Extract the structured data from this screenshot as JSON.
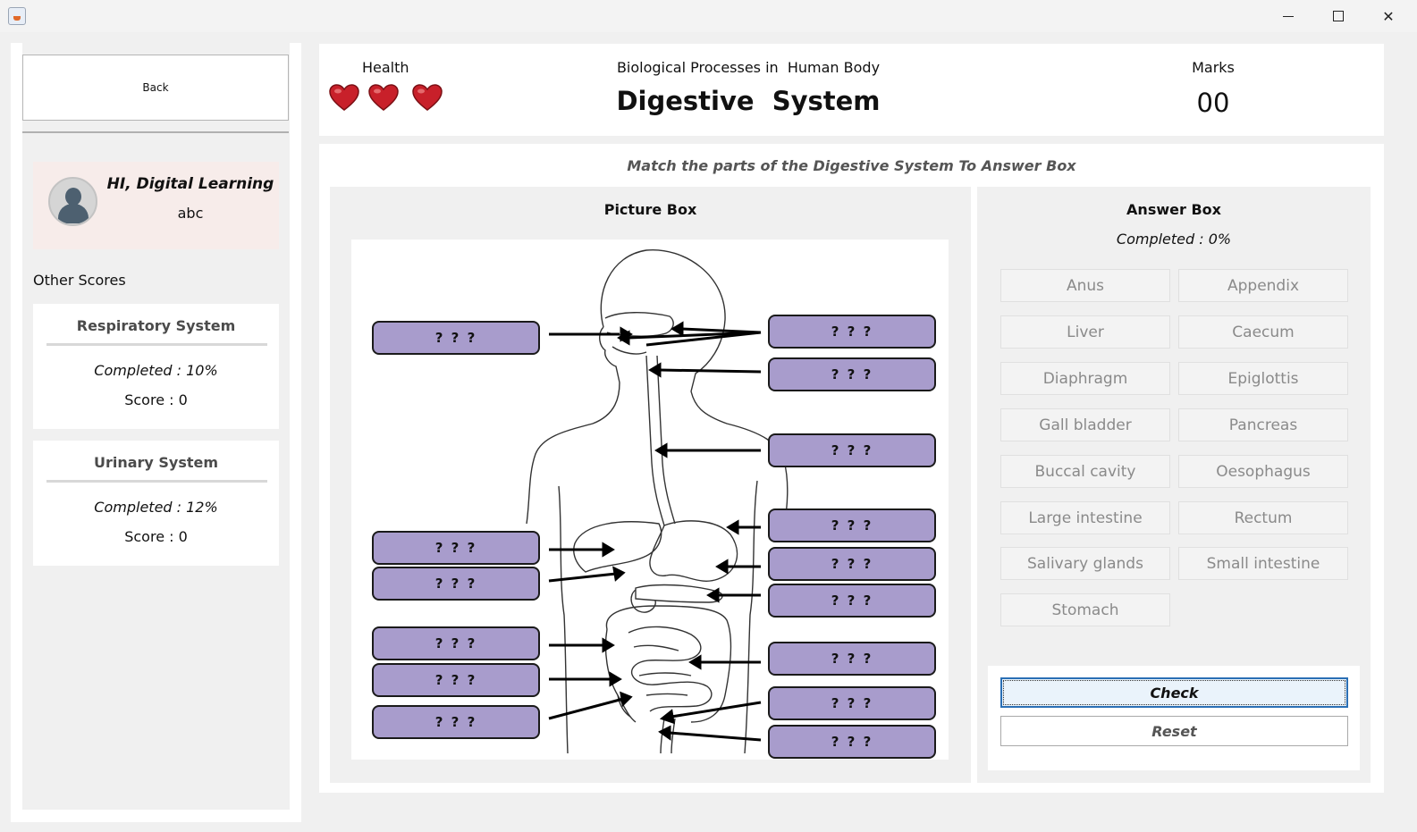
{
  "window": {
    "minimize_glyph": "",
    "close_glyph": "✕"
  },
  "sidebar": {
    "back_label": "Back",
    "greeting": "HI, Digital Learning",
    "username": "abc",
    "other_scores_label": "Other Scores",
    "score_cards": [
      {
        "title": "Respiratory System",
        "completed": "Completed : 10%",
        "score": "Score : 0"
      },
      {
        "title": "Urinary System",
        "completed": "Completed : 12%",
        "score": "Score : 0"
      }
    ]
  },
  "header": {
    "health_label": "Health",
    "health_count": 3,
    "subtitle": "Biological Processes in  Human Body",
    "title": "Digestive  System",
    "marks_label": "Marks",
    "marks_value": "00"
  },
  "game": {
    "instruction": "Match the parts of the Digestive System To Answer Box",
    "picture_box_title": "Picture Box",
    "slot_text": "? ? ?",
    "answer_box_title": "Answer Box",
    "completed": "Completed : 0%",
    "answers": [
      "Anus",
      "Appendix",
      "Liver",
      "Caecum",
      "Diaphragm",
      "Epiglottis",
      "Gall bladder",
      "Pancreas",
      "Buccal cavity",
      "Oesophagus",
      "Large intestine",
      "Rectum",
      "Salivary glands",
      "Small intestine",
      "Stomach"
    ],
    "check_label": "Check",
    "reset_label": "Reset"
  },
  "colors": {
    "slot_fill": "#a89ccc",
    "heart": "#c8202a",
    "check_border": "#2a6fb5"
  },
  "icons": {
    "health": "heart-icon",
    "avatar": "user-avatar-icon",
    "app": "java-app-icon"
  }
}
